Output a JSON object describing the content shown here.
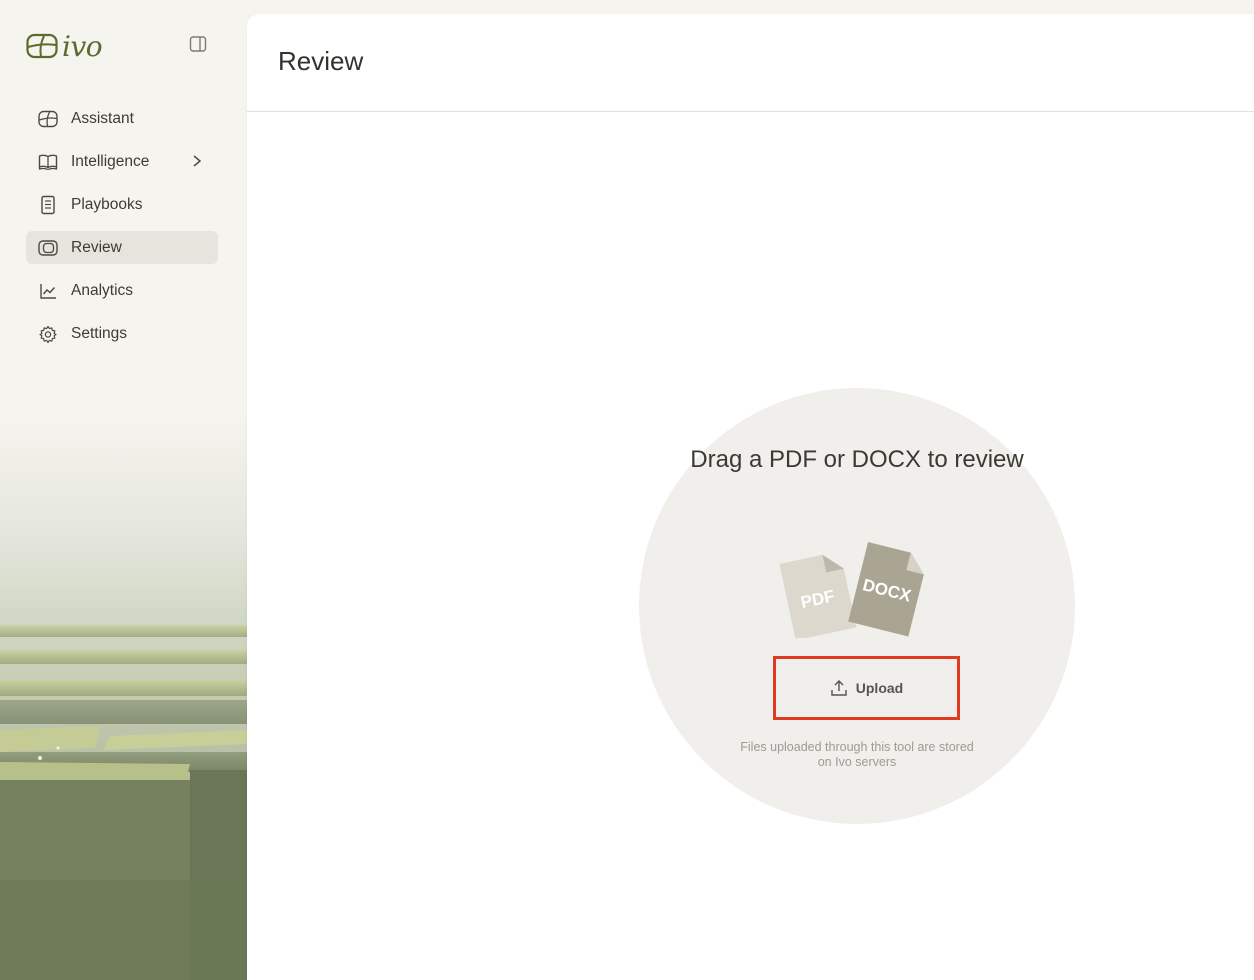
{
  "app": {
    "logo_text": "ivo"
  },
  "sidebar": {
    "items": [
      {
        "label": "Assistant",
        "icon": "assistant-icon",
        "active": false
      },
      {
        "label": "Intelligence",
        "icon": "book-icon",
        "active": false,
        "has_submenu": true
      },
      {
        "label": "Playbooks",
        "icon": "document-icon",
        "active": false
      },
      {
        "label": "Review",
        "icon": "review-icon",
        "active": true
      },
      {
        "label": "Analytics",
        "icon": "chart-icon",
        "active": false
      },
      {
        "label": "Settings",
        "icon": "gear-icon",
        "active": false
      }
    ]
  },
  "main": {
    "title": "Review",
    "dropzone": {
      "title": "Drag a PDF or DOCX to review",
      "file_labels": [
        "PDF",
        "DOCX"
      ],
      "upload_label": "Upload",
      "note": "Files uploaded through this tool are stored on Ivo servers"
    }
  },
  "colors": {
    "brand": "#5b6b2b",
    "active_nav_bg": "#e7e4dd",
    "highlight_border": "#e03a23",
    "dropzone_bg": "#f1efeb"
  }
}
